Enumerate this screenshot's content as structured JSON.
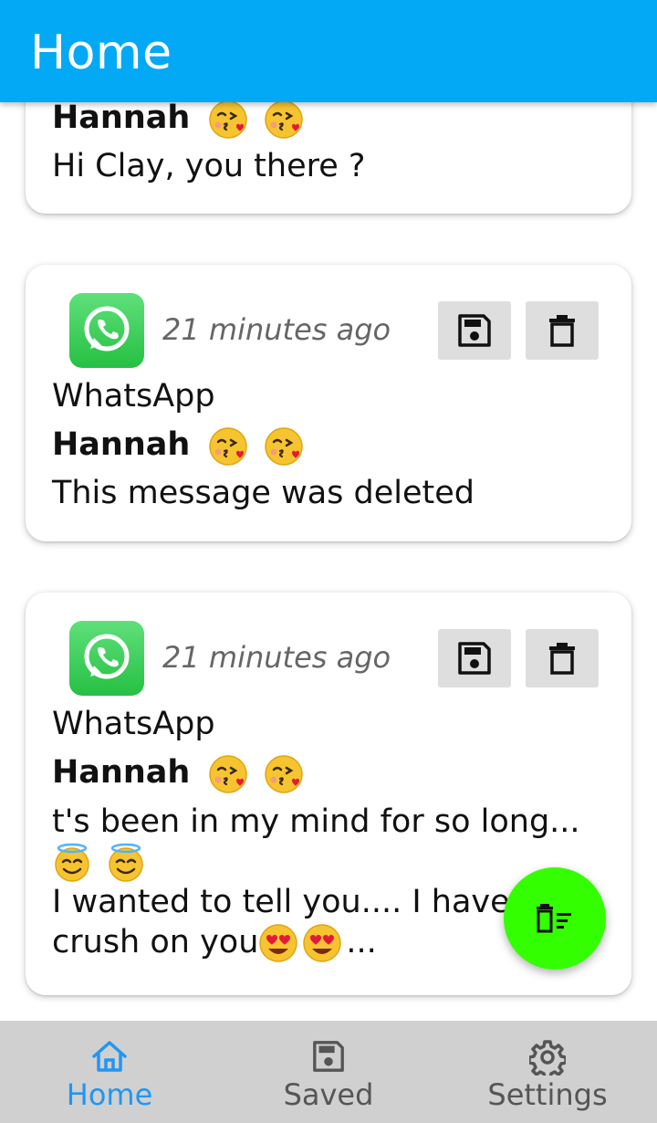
{
  "app_bar": {
    "title": "Home"
  },
  "colors": {
    "primary": "#03a9f4",
    "fab": "#33ff00",
    "whatsapp": "#25d366",
    "nav_active": "#2196f3"
  },
  "cards": [
    {
      "sender": "Hannah",
      "sender_emoji": [
        "kissing-heart-emoji",
        "kissing-heart-emoji"
      ],
      "message": "Hi Clay, you there ?"
    },
    {
      "icon": "whatsapp-icon",
      "time": "21 minutes ago",
      "app": "WhatsApp",
      "sender": "Hannah",
      "sender_emoji": [
        "kissing-heart-emoji",
        "kissing-heart-emoji"
      ],
      "message": "This message was deleted",
      "save_icon": "save-icon",
      "delete_icon": "trash-icon"
    },
    {
      "icon": "whatsapp-icon",
      "time": "21 minutes ago",
      "app": "WhatsApp",
      "sender": "Hannah",
      "sender_emoji": [
        "kissing-heart-emoji",
        "kissing-heart-emoji"
      ],
      "message_line1": "t's been in my mind for so long...",
      "message_line2_emoji": [
        "smiling-halo-emoji",
        "smiling-halo-emoji"
      ],
      "message_line3": "I wanted to tell you.... I have a",
      "message_line4": "crush on you",
      "message_line4_emoji": [
        "heart-eyes-emoji",
        "heart-eyes-emoji"
      ],
      "message_line4_suffix": "...",
      "save_icon": "save-icon",
      "delete_icon": "trash-icon"
    }
  ],
  "fab": {
    "icon": "delete-sweep-icon"
  },
  "bottom_nav": {
    "items": [
      {
        "label": "Home",
        "icon": "home-icon",
        "active": true
      },
      {
        "label": "Saved",
        "icon": "save-icon",
        "active": false
      },
      {
        "label": "Settings",
        "icon": "gear-icon",
        "active": false
      }
    ]
  }
}
